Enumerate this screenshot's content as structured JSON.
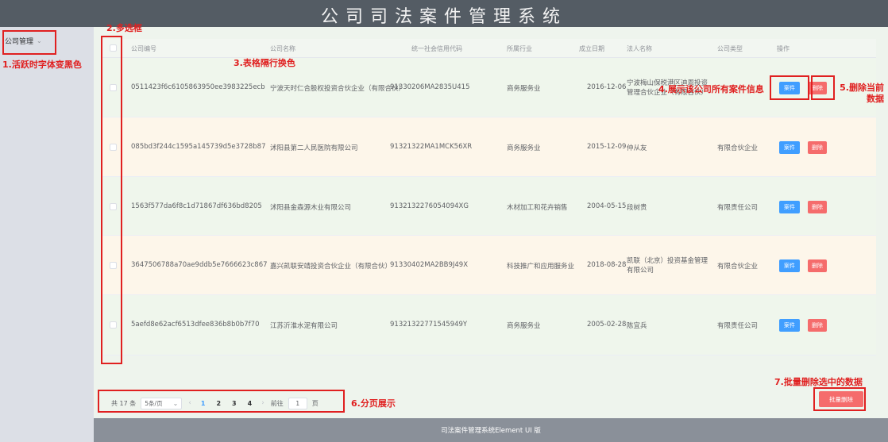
{
  "app": {
    "title": "公司司法案件管理系统",
    "footer": "司法案件管理系统Element UI 版"
  },
  "sidebar": {
    "items": [
      {
        "label": "公司管理"
      }
    ]
  },
  "table": {
    "columns": [
      "公司编号",
      "公司名称",
      "统一社会信用代码",
      "所属行业",
      "成立日期",
      "法人名称",
      "公司类型",
      "操作"
    ],
    "rows": [
      {
        "id": "0511423f6c6105863950ee3983225ecb",
        "name": "宁波天时仁合股权投资合伙企业（有限合伙）",
        "code": "91330206MA2835U415",
        "industry": "商务服务业",
        "date": "2016-12-06",
        "legal": "宁波梅山保税港区迪恩投资管理合伙企业（有限合伙）",
        "type": ""
      },
      {
        "id": "085bd3f244c1595a145739d5e3728b87",
        "name": "沭阳县第二人民医院有限公司",
        "code": "91321322MA1MCK56XR",
        "industry": "商务服务业",
        "date": "2015-12-09",
        "legal": "仲从友",
        "type": "有限合伙企业"
      },
      {
        "id": "1563f577da6f8c1d71867df636bd8205",
        "name": "沭阳县金森源木业有限公司",
        "code": "9132132276054094XG",
        "industry": "木材加工和花卉销售",
        "date": "2004-05-15",
        "legal": "段树贵",
        "type": "有限责任公司"
      },
      {
        "id": "3647506788a70ae9ddb5e7666623c867",
        "name": "嘉兴凯联安靖投资合伙企业（有限合伙）",
        "code": "91330402MA2BB9J49X",
        "industry": "科技推广和应用服务业",
        "date": "2018-08-28",
        "legal": "凯联（北京）投资基金管理有限公司",
        "type": "有限合伙企业"
      },
      {
        "id": "5aefd8e62acf6513dfee836b8b0b7f70",
        "name": "江苏沂淮水泥有限公司",
        "code": "91321322771545949Y",
        "industry": "商务服务业",
        "date": "2005-02-28",
        "legal": "陈宜兵",
        "type": "有限责任公司"
      }
    ],
    "btn_case": "案件",
    "btn_delete": "删除"
  },
  "pagination": {
    "total": "共 17 条",
    "page_size": "5条/页",
    "pages": [
      "1",
      "2",
      "3",
      "4"
    ],
    "goto_prefix": "前往",
    "goto_value": "1",
    "goto_suffix": "页"
  },
  "batch_delete": "批量删除",
  "annotations": {
    "a1": "1.活跃时字体变黑色",
    "a2": "2.多选框",
    "a3": "3.表格隔行换色",
    "a4": "4.展示该公司所有案件信息",
    "a5": "5.删除当前数据",
    "a6": "6.分页展示",
    "a7": "7.批量删除选中的数据"
  },
  "colors": {
    "header": "#545c64",
    "primary": "#409eff",
    "danger": "#f56c6c",
    "annotation": "#e02020"
  }
}
